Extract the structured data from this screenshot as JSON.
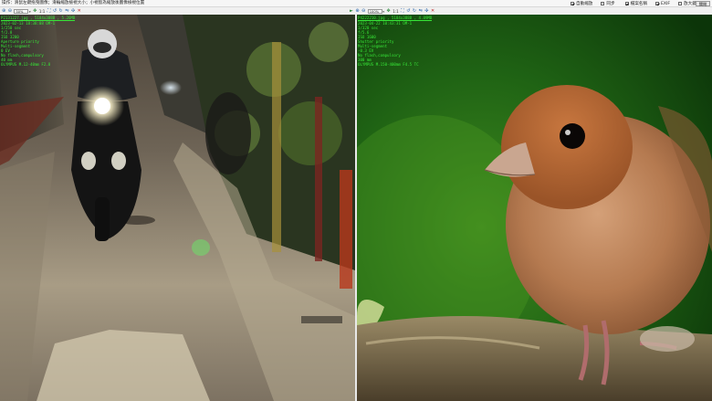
{
  "topbar": {
    "hint": "操作：滑鼠左鍵拖曳圖像；滑輪縮放檢視大小；小視窗為縮放後圖像檢視位置",
    "options": [
      {
        "label": "自動縮放",
        "checked": true
      },
      {
        "label": "同步",
        "checked": false
      },
      {
        "label": "檔案名稱",
        "checked": true
      },
      {
        "label": "EXIF",
        "checked": true
      },
      {
        "label": "放大鏡",
        "checked": false
      }
    ],
    "close_label": "關閉"
  },
  "left_pane": {
    "zoom": "30%",
    "ratio": "1:1",
    "exif": {
      "filename": "P2131227.jpg , 5184x3888 , 5.26MB",
      "lines": [
        "2023-02-13 18:38:08 OM-1",
        "1/250 sec",
        "f/2.8",
        "ISO 3200",
        "Aperture priority",
        "Multi-segment",
        "0 EV",
        "No flash,compulsory",
        "40 mm",
        "OLYMPUS M.12-40mm F2.8"
      ]
    }
  },
  "right_pane": {
    "zoom": "100%",
    "ratio": "1:1",
    "exif": {
      "filename": "P4222210.jpg , 5184x3888 , 4.89MB",
      "lines": [
        "2023-04-22 10:43:31 OM-1",
        "1/320 sec",
        "f/5.6",
        "ISO 1600",
        "Shutter priority",
        "Multi-segment",
        "-0.3 EV",
        "No flash,compulsory",
        "300 mm",
        "OLYMPUS M.150-400mm F4.5 TC"
      ]
    }
  }
}
